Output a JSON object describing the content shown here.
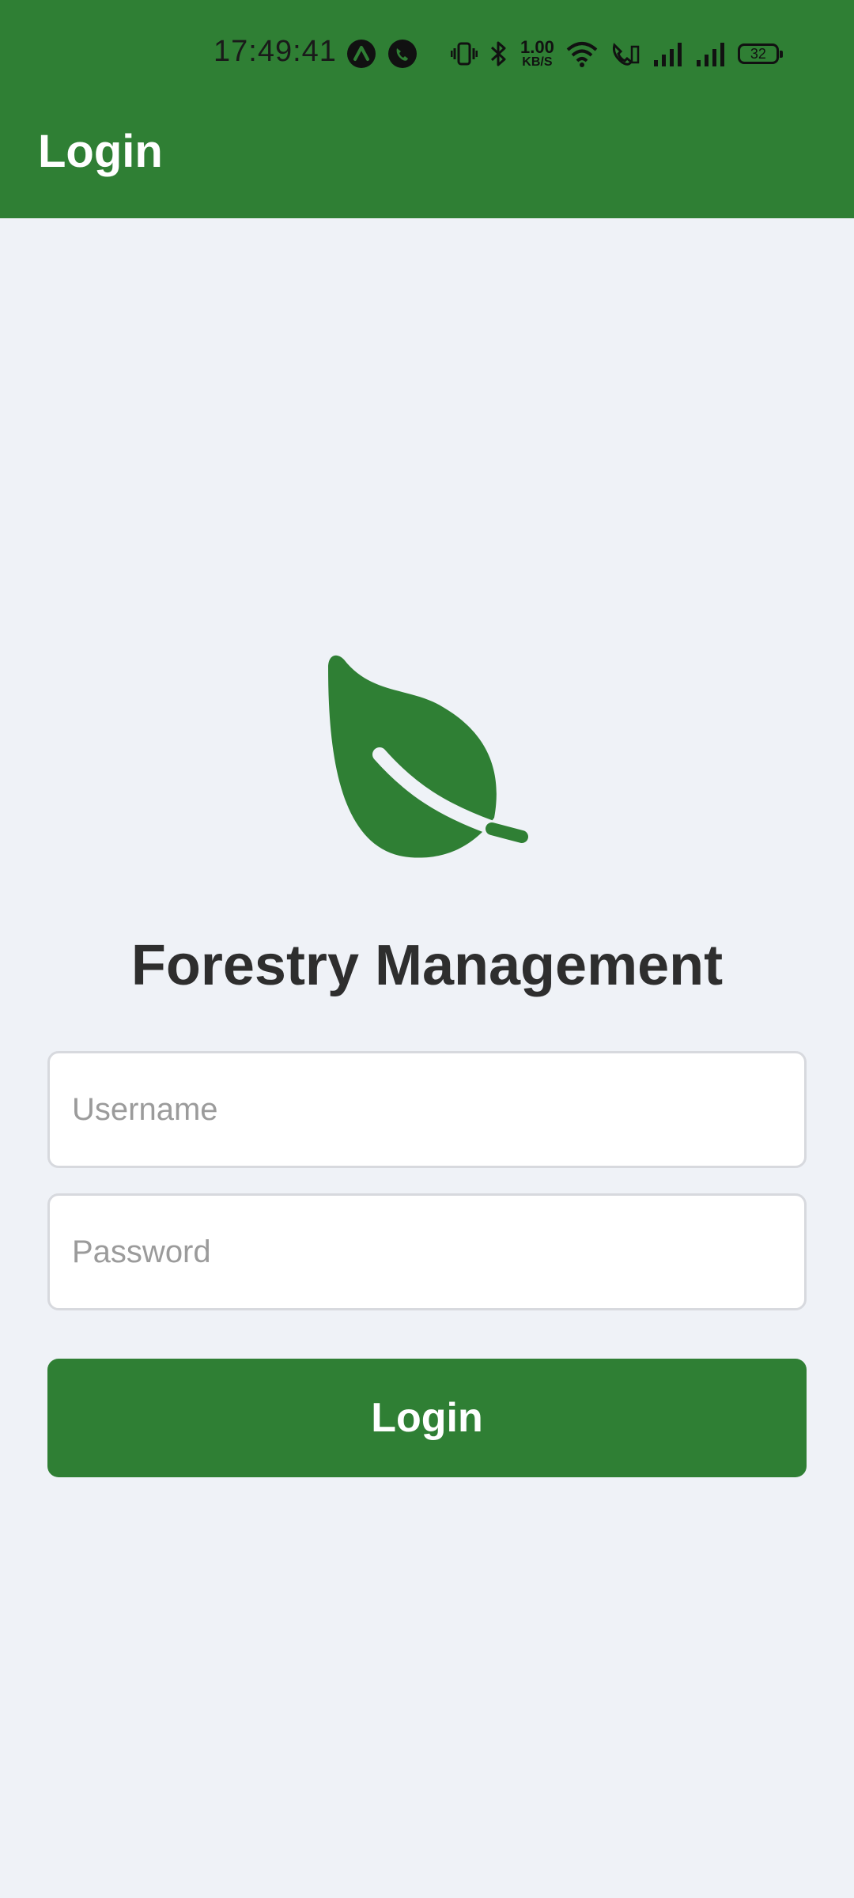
{
  "status_bar": {
    "time": "17:49:41",
    "net_speed_value": "1.00",
    "net_speed_unit": "KB/S",
    "battery": "32",
    "icons": [
      "a-circle-icon",
      "phone-badge-icon",
      "vibrate-icon",
      "bluetooth-icon",
      "wifi-icon",
      "wifi-calling-icon",
      "signal-icon",
      "signal-icon"
    ]
  },
  "app_bar": {
    "title": "Login",
    "color": "#2f7f34"
  },
  "main": {
    "logo_icon": "leaf-icon",
    "heading": "Forestry Management",
    "username_placeholder": "Username",
    "password_placeholder": "Password",
    "login_label": "Login"
  },
  "colors": {
    "primary": "#2f7f34",
    "background": "#eff2f7"
  }
}
